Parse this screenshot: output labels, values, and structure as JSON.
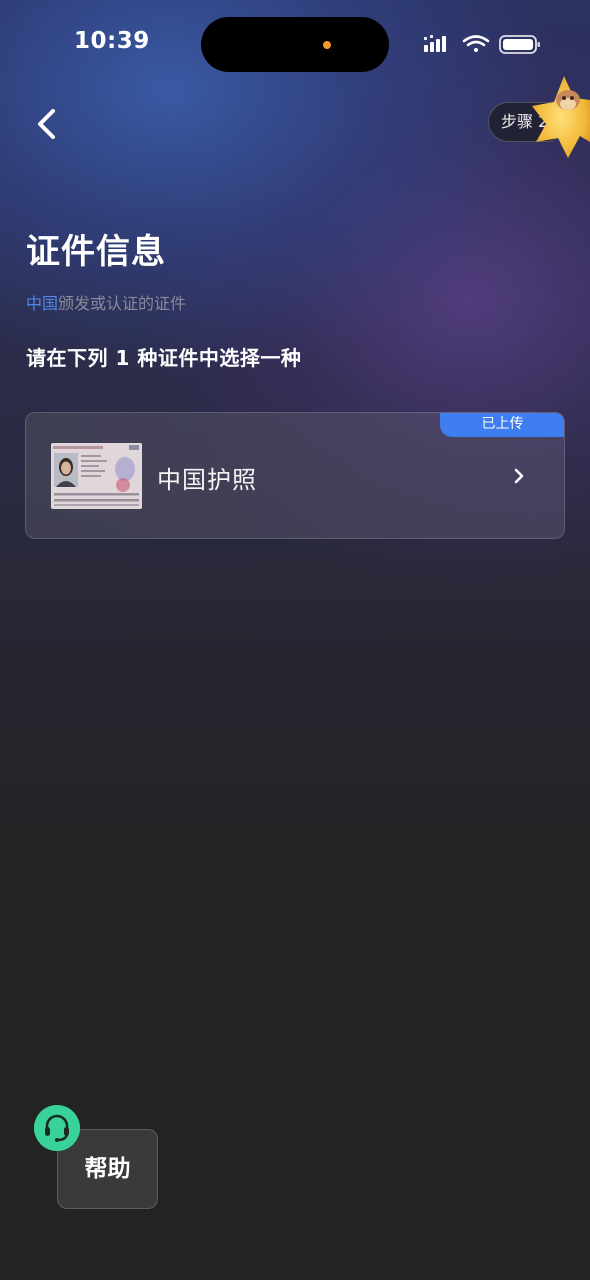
{
  "status_bar": {
    "time": "10:39"
  },
  "nav": {
    "back_icon": "chevron-left-icon",
    "step_label": "步骤 2"
  },
  "page": {
    "title": "证件信息",
    "subtitle_highlight": "中国",
    "subtitle_rest": "颁发或认证的证件",
    "instruction": "请在下列 1 种证件中选择一种"
  },
  "documents": [
    {
      "name": "中国护照",
      "badge": "已上传",
      "icon": "passport-thumbnail"
    }
  ],
  "help": {
    "label": "帮助",
    "icon": "headset-icon"
  },
  "colors": {
    "accent_blue": "#3f7ef0",
    "highlight_text": "#4f87e6",
    "help_green": "#39d29b",
    "background": "#232323"
  }
}
